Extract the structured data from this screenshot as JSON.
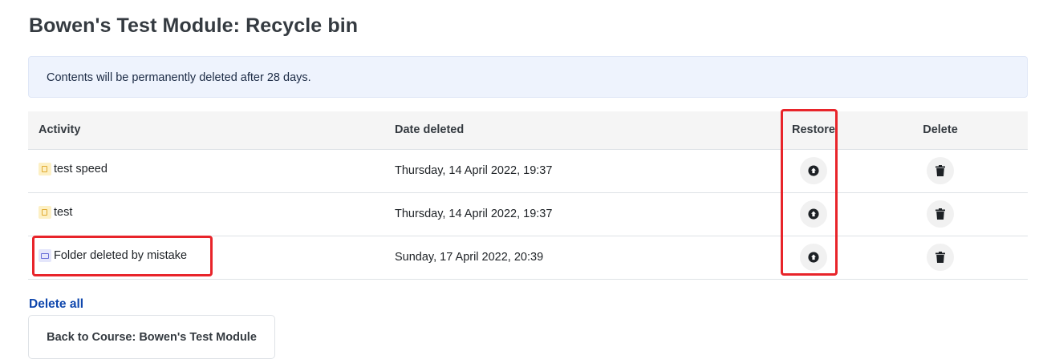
{
  "page": {
    "title": "Bowen's Test Module: Recycle bin"
  },
  "notice": {
    "text": "Contents will be permanently deleted after 28 days."
  },
  "table": {
    "headers": {
      "activity": "Activity",
      "date_deleted": "Date deleted",
      "restore": "Restore",
      "delete": "Delete"
    },
    "rows": [
      {
        "activity": "test speed",
        "icon": "page-icon",
        "date_deleted": "Thursday, 14 April 2022, 19:37"
      },
      {
        "activity": "test",
        "icon": "page-icon",
        "date_deleted": "Thursday, 14 April 2022, 19:37"
      },
      {
        "activity": "Folder deleted by mistake",
        "icon": "folder-icon",
        "date_deleted": "Sunday, 17 April 2022, 20:39"
      }
    ]
  },
  "actions": {
    "delete_all": "Delete all",
    "back_button": "Back to Course: Bowen's Test Module"
  },
  "colors": {
    "link": "#0f47ad",
    "notice_bg": "#eef3fd",
    "highlight": "#e8242a"
  }
}
